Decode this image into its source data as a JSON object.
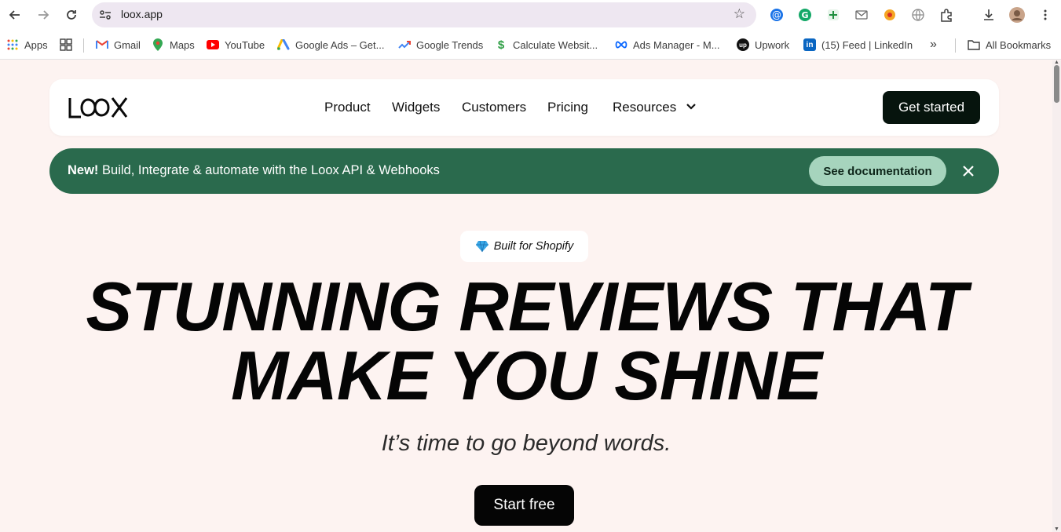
{
  "browser": {
    "url": "loox.app",
    "bookmarks": [
      {
        "label": "Apps"
      },
      {
        "label": "Gmail"
      },
      {
        "label": "Maps"
      },
      {
        "label": "YouTube"
      },
      {
        "label": "Google Ads – Get..."
      },
      {
        "label": "Google Trends"
      },
      {
        "label": "Calculate Websit..."
      },
      {
        "label": "Ads Manager - M..."
      },
      {
        "label": "Upwork"
      },
      {
        "label": "(15) Feed | LinkedIn"
      }
    ],
    "all_bookmarks": "All Bookmarks",
    "overflow": "»"
  },
  "nav": {
    "logo_text": "LOOX",
    "items": [
      {
        "label": "Product"
      },
      {
        "label": "Widgets"
      },
      {
        "label": "Customers"
      },
      {
        "label": "Pricing"
      },
      {
        "label": "Resources"
      }
    ],
    "cta": "Get started"
  },
  "banner": {
    "new_label": "New!",
    "text": " Build, Integrate & automate with the Loox API & Webhooks",
    "button": "See documentation",
    "color": "#2a6a4d"
  },
  "hero": {
    "badge": "Built for Shopify",
    "headline_line1": "STUNNING REVIEWS THAT",
    "headline_line2": "MAKE YOU SHINE",
    "subheadline": "It’s time to go beyond words.",
    "cta": "Start free"
  }
}
